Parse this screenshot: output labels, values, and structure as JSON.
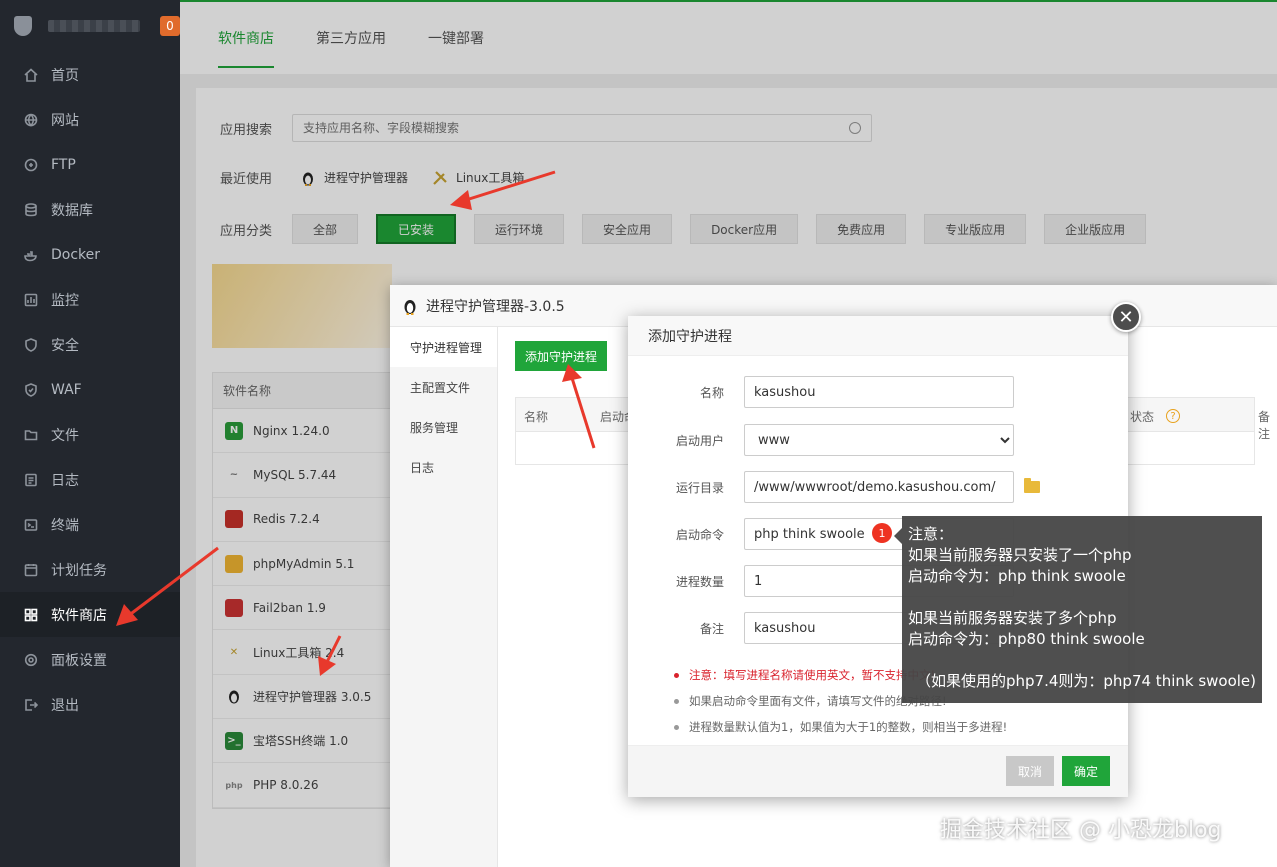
{
  "sidebar": {
    "badge": "0",
    "items": [
      {
        "label": "首页",
        "icon": "home-icon"
      },
      {
        "label": "网站",
        "icon": "globe-icon"
      },
      {
        "label": "FTP",
        "icon": "ftp-icon"
      },
      {
        "label": "数据库",
        "icon": "database-icon"
      },
      {
        "label": "Docker",
        "icon": "docker-icon"
      },
      {
        "label": "监控",
        "icon": "monitor-icon"
      },
      {
        "label": "安全",
        "icon": "shield-icon"
      },
      {
        "label": "WAF",
        "icon": "waf-icon"
      },
      {
        "label": "文件",
        "icon": "folder-icon"
      },
      {
        "label": "日志",
        "icon": "log-icon"
      },
      {
        "label": "终端",
        "icon": "terminal-icon"
      },
      {
        "label": "计划任务",
        "icon": "clock-icon"
      },
      {
        "label": "软件商店",
        "icon": "grid-icon"
      },
      {
        "label": "面板设置",
        "icon": "gear-icon"
      },
      {
        "label": "退出",
        "icon": "logout-icon"
      }
    ]
  },
  "tabs": [
    "软件商店",
    "第三方应用",
    "一键部署"
  ],
  "store": {
    "search_label": "应用搜索",
    "search_placeholder": "支持应用名称、字段模糊搜索",
    "recent_label": "最近使用",
    "recent": [
      "进程守护管理器",
      "Linux工具箱"
    ],
    "category_label": "应用分类",
    "categories": [
      "全部",
      "已安装",
      "运行环境",
      "安全应用",
      "Docker应用",
      "免费应用",
      "专业版应用",
      "企业版应用"
    ]
  },
  "soft_table": {
    "header": "软件名称",
    "rows": [
      "Nginx 1.24.0",
      "MySQL 5.7.44",
      "Redis 7.2.4",
      "phpMyAdmin 5.1",
      "Fail2ban 1.9",
      "Linux工具箱 2.4",
      "进程守护管理器 3.0.5",
      "宝塔SSH终端 1.0",
      "PHP 8.0.26"
    ]
  },
  "manager": {
    "title": "进程守护管理器-3.0.5",
    "menu": [
      "守护进程管理",
      "主配置文件",
      "服务管理",
      "日志"
    ],
    "add_button": "添加守护进程",
    "columns": [
      "名称",
      "启动命",
      "状态",
      "备注"
    ]
  },
  "dialog": {
    "title": "添加守护进程",
    "fields": {
      "name_label": "名称",
      "name_value": "kasushou",
      "user_label": "启动用户",
      "user_value": "www",
      "dir_label": "运行目录",
      "dir_value": "/www/wwwroot/demo.kasushou.com/",
      "cmd_label": "启动命令",
      "cmd_value": "php think swoole",
      "count_label": "进程数量",
      "count_value": "1",
      "note_label": "备注",
      "note_value": "kasushou"
    },
    "badge": "1",
    "notes": [
      "注意：填写进程名称请使用英文，暂不支持中文!",
      "如果启动命令里面有文件，请填写文件的绝对路径!",
      "进程数量默认值为1，如果值为大于1的整数，则相当于多进程!"
    ],
    "cancel": "取消",
    "ok": "确定"
  },
  "tooltip": {
    "lines": [
      "注意：",
      "如果当前服务器只安装了一个php",
      "启动命令为：php think swoole",
      "",
      "如果当前服务器安装了多个php",
      "启动命令为：php80 think swoole",
      "",
      "（如果使用的php7.4则为：php74 think swoole)"
    ]
  },
  "watermark": "掘金技术社区 @ 小恐龙blog",
  "colors": {
    "accent": "#20a53a",
    "sidebar": "#23272e",
    "arrow": "#e8392c"
  }
}
